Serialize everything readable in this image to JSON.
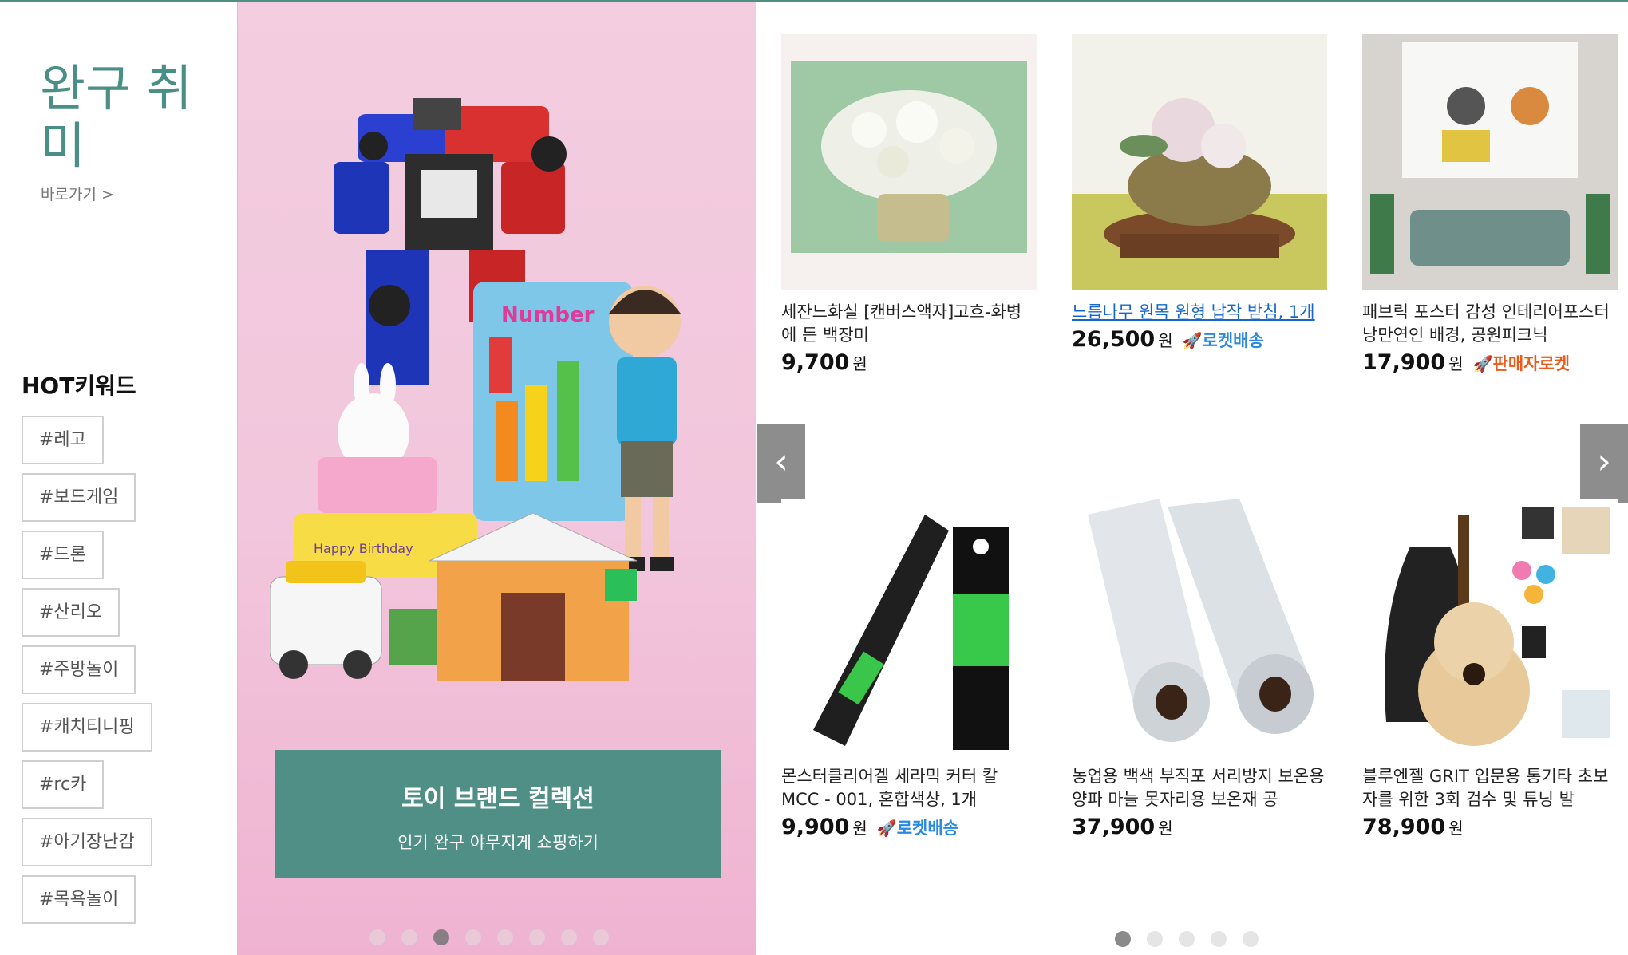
{
  "category": {
    "title": "완구 취미",
    "shortcut": "바로가기 >"
  },
  "hot_keywords": {
    "title": "HOT키워드",
    "items": [
      "#레고",
      "#보드게임",
      "#드론",
      "#산리오",
      "#주방놀이",
      "#캐치티니핑",
      "#rc카",
      "#아기장난감",
      "#목욕놀이"
    ]
  },
  "banner": {
    "caption_title": "토이 브랜드 컬렉션",
    "caption_sub": "인기 완구 야무지게 쇼핑하기",
    "slide_count": 8,
    "active_slide": 3
  },
  "products": [
    {
      "name": "세잔느화실 [캔버스액자]고흐-화병에 든 백장미",
      "price": "9,700",
      "unit": "원",
      "badge": "",
      "badge_type": ""
    },
    {
      "name": "느릅나무 원목 원형 납작 받침, 1개",
      "price": "26,500",
      "unit": "원",
      "badge": "로켓배송",
      "badge_type": "rocket"
    },
    {
      "name": "패브릭 포스터 감성 인테리어포스터 낭만연인 배경, 공원피크닉",
      "price": "17,900",
      "unit": "원",
      "badge": "판매자로켓",
      "badge_type": "seller"
    },
    {
      "name": "몬스터클리어겔 세라믹 커터 칼 MCC - 001, 혼합색상, 1개",
      "price": "9,900",
      "unit": "원",
      "badge": "로켓배송",
      "badge_type": "rocket"
    },
    {
      "name": "농업용 백색 부직포 서리방지 보온용 양파 마늘 못자리용 보온재 공",
      "price": "37,900",
      "unit": "원",
      "badge": "",
      "badge_type": ""
    },
    {
      "name": "블루엔젤 GRIT 입문용 통기타 초보자를 위한 3회 검수 및 튜닝 발",
      "price": "78,900",
      "unit": "원",
      "badge": "",
      "badge_type": ""
    }
  ],
  "grid_pager": {
    "slide_count": 5,
    "active_slide": 1
  },
  "icons": {
    "prev": "chevron-left-icon",
    "next": "chevron-right-icon",
    "rocket": "rocket-icon"
  },
  "colors": {
    "accent": "#4f8f85",
    "rocket": "#2a89e0",
    "seller_rocket": "#ea5a1a",
    "banner_bg": "#f2c6dc"
  }
}
